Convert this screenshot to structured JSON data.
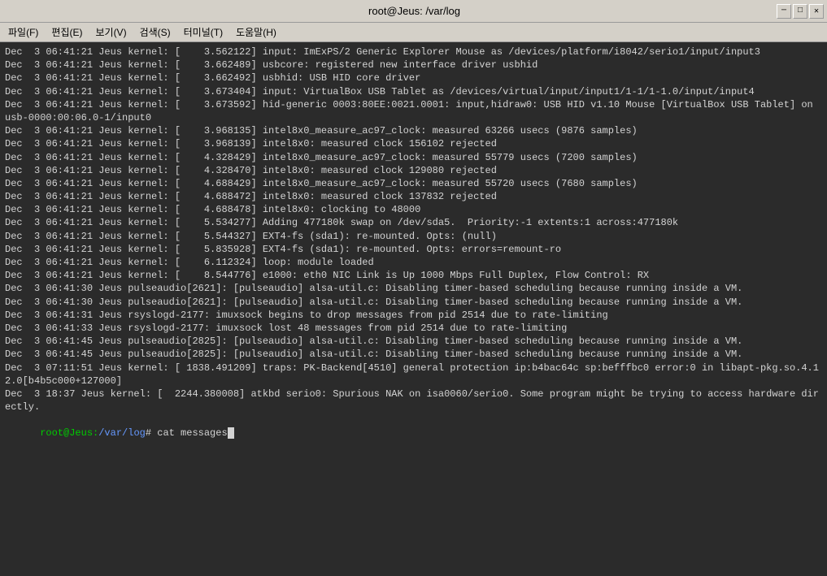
{
  "titlebar": {
    "title": "root@Jeus: /var/log",
    "minimize_label": "─",
    "maximize_label": "□",
    "close_label": "✕"
  },
  "menubar": {
    "items": [
      {
        "label": "파일(F)"
      },
      {
        "label": "편집(E)"
      },
      {
        "label": "보기(V)"
      },
      {
        "label": "검색(S)"
      },
      {
        "label": "터미널(T)"
      },
      {
        "label": "도움말(H)"
      }
    ]
  },
  "terminal": {
    "lines": [
      "Dec  3 06:41:21 Jeus kernel: [    3.562122] input: ImExPS/2 Generic Explorer Mouse as /devices/platform/i8042/serio1/input/input3",
      "Dec  3 06:41:21 Jeus kernel: [    3.662489] usbcore: registered new interface driver usbhid",
      "Dec  3 06:41:21 Jeus kernel: [    3.662492] usbhid: USB HID core driver",
      "Dec  3 06:41:21 Jeus kernel: [    3.673404] input: VirtualBox USB Tablet as /devices/virtual/input/input1/1-1/1-1.0/input/input4",
      "Dec  3 06:41:21 Jeus kernel: [    3.673592] hid-generic 0003:80EE:0021.0001: input,hidraw0: USB HID v1.10 Mouse [VirtualBox USB Tablet] on usb-0000:00:06.0-1/input0",
      "Dec  3 06:41:21 Jeus kernel: [    3.968135] intel8x0_measure_ac97_clock: measured 63266 usecs (9876 samples)",
      "Dec  3 06:41:21 Jeus kernel: [    3.968139] intel8x0: measured clock 156102 rejected",
      "Dec  3 06:41:21 Jeus kernel: [    4.328429] intel8x0_measure_ac97_clock: measured 55779 usecs (7200 samples)",
      "Dec  3 06:41:21 Jeus kernel: [    4.328470] intel8x0: measured clock 129080 rejected",
      "Dec  3 06:41:21 Jeus kernel: [    4.688429] intel8x0_measure_ac97_clock: measured 55720 usecs (7680 samples)",
      "Dec  3 06:41:21 Jeus kernel: [    4.688472] intel8x0: measured clock 137832 rejected",
      "Dec  3 06:41:21 Jeus kernel: [    4.688478] intel8x0: clocking to 48000",
      "Dec  3 06:41:21 Jeus kernel: [    5.534277] Adding 477180k swap on /dev/sda5.  Priority:-1 extents:1 across:477180k",
      "Dec  3 06:41:21 Jeus kernel: [    5.544327] EXT4-fs (sda1): re-mounted. Opts: (null)",
      "Dec  3 06:41:21 Jeus kernel: [    5.835928] EXT4-fs (sda1): re-mounted. Opts: errors=remount-ro",
      "Dec  3 06:41:21 Jeus kernel: [    6.112324] loop: module loaded",
      "Dec  3 06:41:21 Jeus kernel: [    8.544776] e1000: eth0 NIC Link is Up 1000 Mbps Full Duplex, Flow Control: RX",
      "Dec  3 06:41:30 Jeus pulseaudio[2621]: [pulseaudio] alsa-util.c: Disabling timer-based scheduling because running inside a VM.",
      "Dec  3 06:41:30 Jeus pulseaudio[2621]: [pulseaudio] alsa-util.c: Disabling timer-based scheduling because running inside a VM.",
      "Dec  3 06:41:31 Jeus rsyslogd-2177: imuxsock begins to drop messages from pid 2514 due to rate-limiting",
      "Dec  3 06:41:33 Jeus rsyslogd-2177: imuxsock lost 48 messages from pid 2514 due to rate-limiting",
      "Dec  3 06:41:45 Jeus pulseaudio[2825]: [pulseaudio] alsa-util.c: Disabling timer-based scheduling because running inside a VM.",
      "Dec  3 06:41:45 Jeus pulseaudio[2825]: [pulseaudio] alsa-util.c: Disabling timer-based scheduling because running inside a VM.",
      "Dec  3 07:11:51 Jeus kernel: [ 1838.491209] traps: PK-Backend[4510] general protection ip:b4bac64c sp:befffbc0 error:0 in libapt-pkg.so.4.12.0[b4b5c000+127000]",
      "Dec  3 18:37 Jeus kernel: [  2244.380008] atkbd serio0: Spurious NAK on isa0060/serio0. Some program might be trying to access hardware directly."
    ],
    "prompt_user": "root@Jeus",
    "prompt_path": "/var/log",
    "prompt_command": "cat messages"
  }
}
